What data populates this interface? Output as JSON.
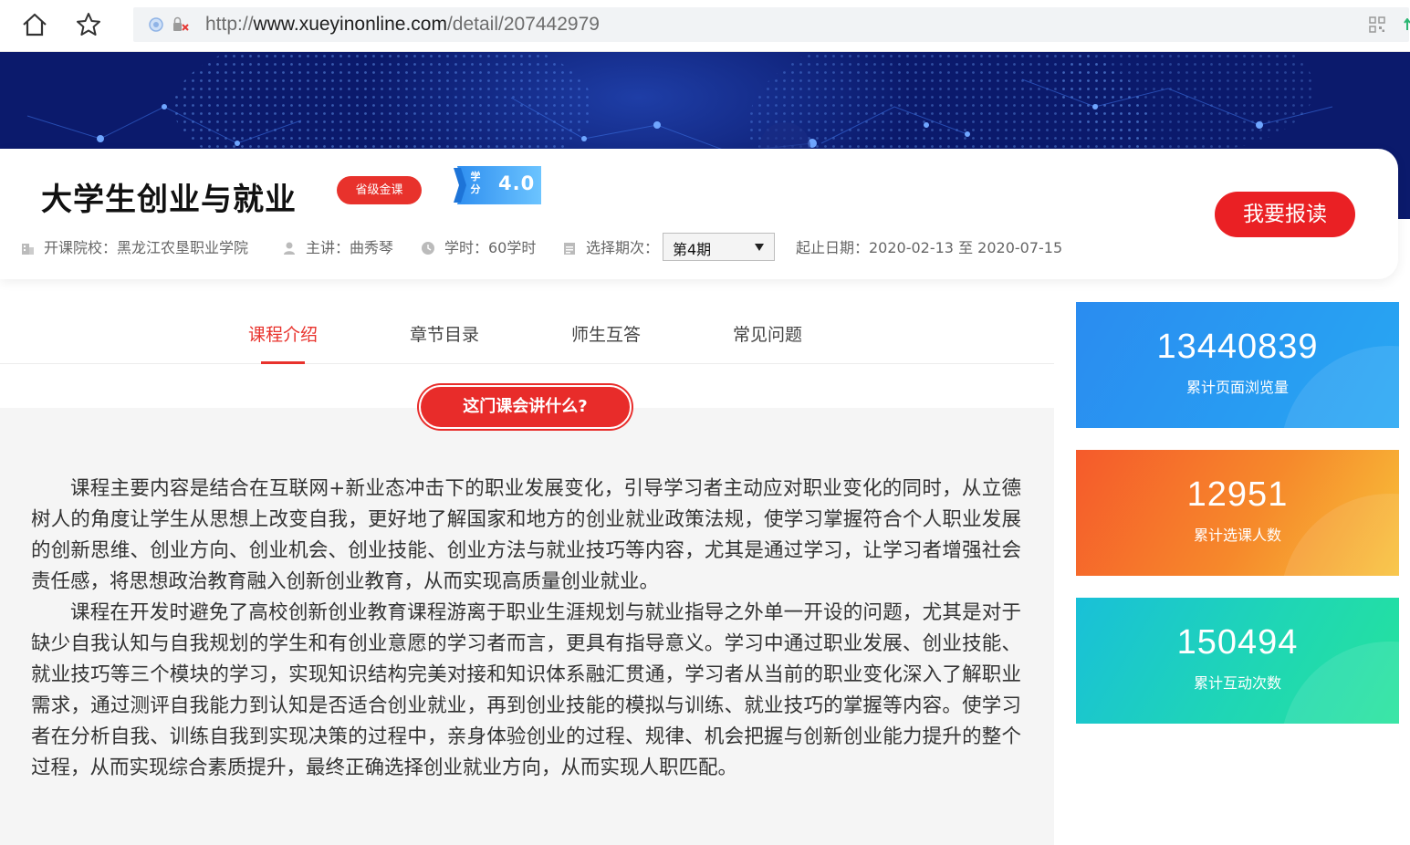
{
  "browser": {
    "url_prefix": "http://",
    "url_domain": "www.xueyinonline.com",
    "url_path": "/detail/207442979"
  },
  "course": {
    "title": "大学生创业与就业",
    "badge": "省级金课",
    "credit_label": "学分",
    "credit_value": "4.0",
    "enroll_button": "我要报读",
    "meta": {
      "school": "开课院校：黑龙江农垦职业学院",
      "teacher": "主讲：曲秀琴",
      "hours": "学时：60学时",
      "term_label": "选择期次：",
      "term_selected": "第4期",
      "dates": "起止日期：2020-02-13 至 2020-07-15"
    }
  },
  "tabs": [
    {
      "label": "课程介绍",
      "active": true
    },
    {
      "label": "章节目录",
      "active": false
    },
    {
      "label": "师生互答",
      "active": false
    },
    {
      "label": "常见问题",
      "active": false
    }
  ],
  "intro": {
    "heading": "这门课会讲什么?",
    "paragraphs": [
      "课程主要内容是结合在互联网+新业态冲击下的职业发展变化，引导学习者主动应对职业变化的同时，从立德树人的角度让学生从思想上改变自我，更好地了解国家和地方的创业就业政策法规，使学习掌握符合个人职业发展的创新思维、创业方向、创业机会、创业技能、创业方法与就业技巧等内容，尤其是通过学习，让学习者增强社会责任感，将思想政治教育融入创新创业教育，从而实现高质量创业就业。",
      "课程在开发时避免了高校创新创业教育课程游离于职业生涯规划与就业指导之外单一开设的问题，尤其是对于缺少自我认知与自我规划的学生和有创业意愿的学习者而言，更具有指导意义。学习中通过职业发展、创业技能、就业技巧等三个模块的学习，实现知识结构完美对接和知识体系融汇贯通，学习者从当前的职业变化深入了解职业需求，通过测评自我能力到认知是否适合创业就业，再到创业技能的模拟与训练、就业技巧的掌握等内容。使学习者在分析自我、训练自我到实现决策的过程中，亲身体验创业的过程、规律、机会把握与创新创业能力提升的整个过程，从而实现综合素质提升，最终正确选择创业就业方向，从而实现人职匹配。"
    ]
  },
  "stats": [
    {
      "value": "13440839",
      "label": "累计页面浏览量"
    },
    {
      "value": "12951",
      "label": "累计选课人数"
    },
    {
      "value": "150494",
      "label": "累计互动次数"
    }
  ],
  "colors": {
    "accent_red": "#e8322c",
    "stat_blue": "#2a8cf0",
    "stat_orange": "#f6892b",
    "stat_green": "#1fd6b5"
  },
  "icons": [
    "home-icon",
    "star-icon",
    "security-icon",
    "qr-code-icon",
    "building-icon",
    "teacher-icon",
    "clock-icon",
    "calendar-icon",
    "dropdown-arrow-icon"
  ]
}
